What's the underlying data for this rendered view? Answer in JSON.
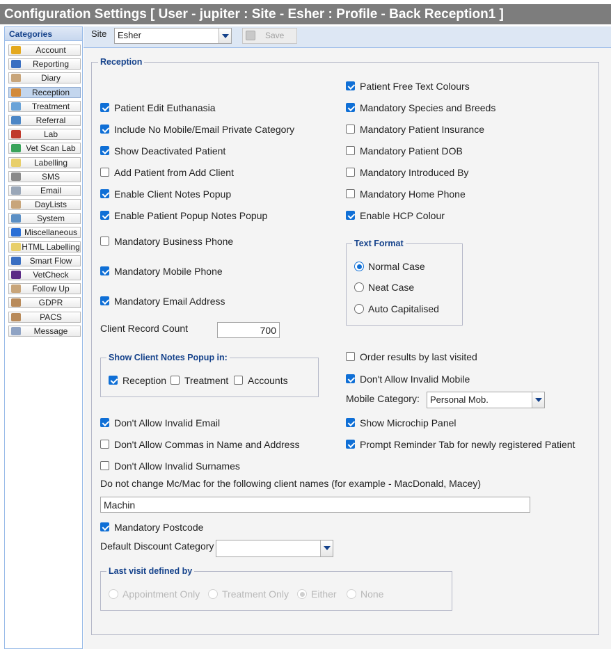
{
  "window": {
    "title": "Configuration Settings [ User - jupiter : Site - Esher : Profile - Back Reception1 ]"
  },
  "sidebar": {
    "heading": "Categories",
    "items": [
      {
        "label": "Account",
        "icon": "account-icon",
        "color": "#e4a91f",
        "active": false
      },
      {
        "label": "Reporting",
        "icon": "reporting-icon",
        "color": "#3a6fc2",
        "active": false
      },
      {
        "label": "Diary",
        "icon": "diary-icon",
        "color": "#c8a57a",
        "active": false
      },
      {
        "label": "Reception",
        "icon": "reception-icon",
        "color": "#d28a3a",
        "active": true
      },
      {
        "label": "Treatment",
        "icon": "treatment-icon",
        "color": "#6aa3d8",
        "active": false
      },
      {
        "label": "Referral",
        "icon": "referral-icon",
        "color": "#4b86c6",
        "active": false
      },
      {
        "label": "Lab",
        "icon": "lab-icon",
        "color": "#c0392b",
        "active": false
      },
      {
        "label": "Vet Scan Lab",
        "icon": "vet-scan-lab-icon",
        "color": "#3aa45a",
        "active": false
      },
      {
        "label": "Labelling",
        "icon": "labelling-icon",
        "color": "#e8cf6a",
        "active": false
      },
      {
        "label": "SMS",
        "icon": "sms-icon",
        "color": "#8a8a8a",
        "active": false
      },
      {
        "label": "Email",
        "icon": "email-icon",
        "color": "#9aa7b8",
        "active": false
      },
      {
        "label": "DayLists",
        "icon": "daylists-icon",
        "color": "#c8a57a",
        "active": false
      },
      {
        "label": "System",
        "icon": "system-icon",
        "color": "#5b8fc4",
        "active": false
      },
      {
        "label": "Miscellaneous",
        "icon": "miscellaneous-icon",
        "color": "#2a6fd6",
        "active": false
      },
      {
        "label": "HTML Labelling",
        "icon": "html-labelling-icon",
        "color": "#e8cf6a",
        "active": false
      },
      {
        "label": "Smart Flow",
        "icon": "smart-flow-icon",
        "color": "#3a6fc2",
        "active": false
      },
      {
        "label": "VetCheck",
        "icon": "vetcheck-icon",
        "color": "#5b2a86",
        "active": false
      },
      {
        "label": "Follow Up",
        "icon": "follow-up-icon",
        "color": "#c8a57a",
        "active": false
      },
      {
        "label": "GDPR",
        "icon": "gdpr-icon",
        "color": "#b88a5a",
        "active": false
      },
      {
        "label": "PACS",
        "icon": "pacs-icon",
        "color": "#b88a5a",
        "active": false
      },
      {
        "label": "Message",
        "icon": "message-icon",
        "color": "#8fa3c4",
        "active": false
      }
    ]
  },
  "toolbar": {
    "site_label": "Site",
    "site_value": "Esher",
    "save_label": "Save"
  },
  "reception": {
    "legend": "Reception",
    "left_checks": [
      {
        "label": "Patient Edit Euthanasia",
        "checked": true
      },
      {
        "label": "Include No Mobile/Email Private Category",
        "checked": true
      },
      {
        "label": "Show Deactivated Patient",
        "checked": true
      },
      {
        "label": "Add Patient from Add Client",
        "checked": false
      },
      {
        "label": "Enable Client Notes Popup",
        "checked": true
      },
      {
        "label": "Enable Patient Popup Notes Popup",
        "checked": true
      },
      {
        "label": "Mandatory Business Phone",
        "checked": false
      },
      {
        "label": "Mandatory Mobile Phone",
        "checked": true
      },
      {
        "label": "Mandatory Email Address",
        "checked": true
      }
    ],
    "right_checks": [
      {
        "label": "Patient Free Text Colours",
        "checked": true
      },
      {
        "label": "Mandatory Species and Breeds",
        "checked": true
      },
      {
        "label": "Mandatory Patient Insurance",
        "checked": false
      },
      {
        "label": "Mandatory Patient DOB",
        "checked": false
      },
      {
        "label": "Mandatory Introduced By",
        "checked": false
      },
      {
        "label": "Mandatory Home Phone",
        "checked": false
      },
      {
        "label": "Enable HCP Colour",
        "checked": true
      }
    ],
    "text_format": {
      "legend": "Text Format",
      "options": [
        {
          "label": "Normal Case",
          "selected": true
        },
        {
          "label": "Neat Case",
          "selected": false
        },
        {
          "label": "Auto Capitalised",
          "selected": false
        }
      ]
    },
    "client_record_count": {
      "label": "Client Record Count",
      "value": "700"
    },
    "notes_popup": {
      "legend": "Show Client Notes Popup in:",
      "options": [
        {
          "label": "Reception",
          "checked": true
        },
        {
          "label": "Treatment",
          "checked": false
        },
        {
          "label": "Accounts",
          "checked": false
        }
      ]
    },
    "order_results": {
      "label": "Order results by last visited",
      "checked": false
    },
    "invalid_mobile": {
      "label": "Don't Allow Invalid Mobile",
      "checked": true
    },
    "mobile_category": {
      "label": "Mobile Category:",
      "value": "Personal Mob."
    },
    "invalid_email": {
      "label": "Don't Allow Invalid Email",
      "checked": true
    },
    "microchip_panel": {
      "label": "Show Microchip Panel",
      "checked": true
    },
    "commas": {
      "label": "Don't Allow Commas in Name and Address",
      "checked": false
    },
    "prompt_reminder": {
      "label": "Prompt Reminder Tab for newly registered Patient",
      "checked": true
    },
    "invalid_surnames": {
      "label": "Don't Allow Invalid Surnames",
      "checked": false
    },
    "mcmac_label": "Do not change Mc/Mac for the following client names (for example - MacDonald, Macey)",
    "mcmac_value": "Machin",
    "mandatory_postcode": {
      "label": "Mandatory Postcode",
      "checked": true
    },
    "discount_category": {
      "label": "Default Discount Category",
      "value": ""
    },
    "last_visit": {
      "legend": "Last visit defined by",
      "options": [
        {
          "label": "Appointment Only",
          "selected": false
        },
        {
          "label": "Treatment Only",
          "selected": false
        },
        {
          "label": "Either",
          "selected": true
        },
        {
          "label": "None",
          "selected": false
        }
      ]
    }
  }
}
